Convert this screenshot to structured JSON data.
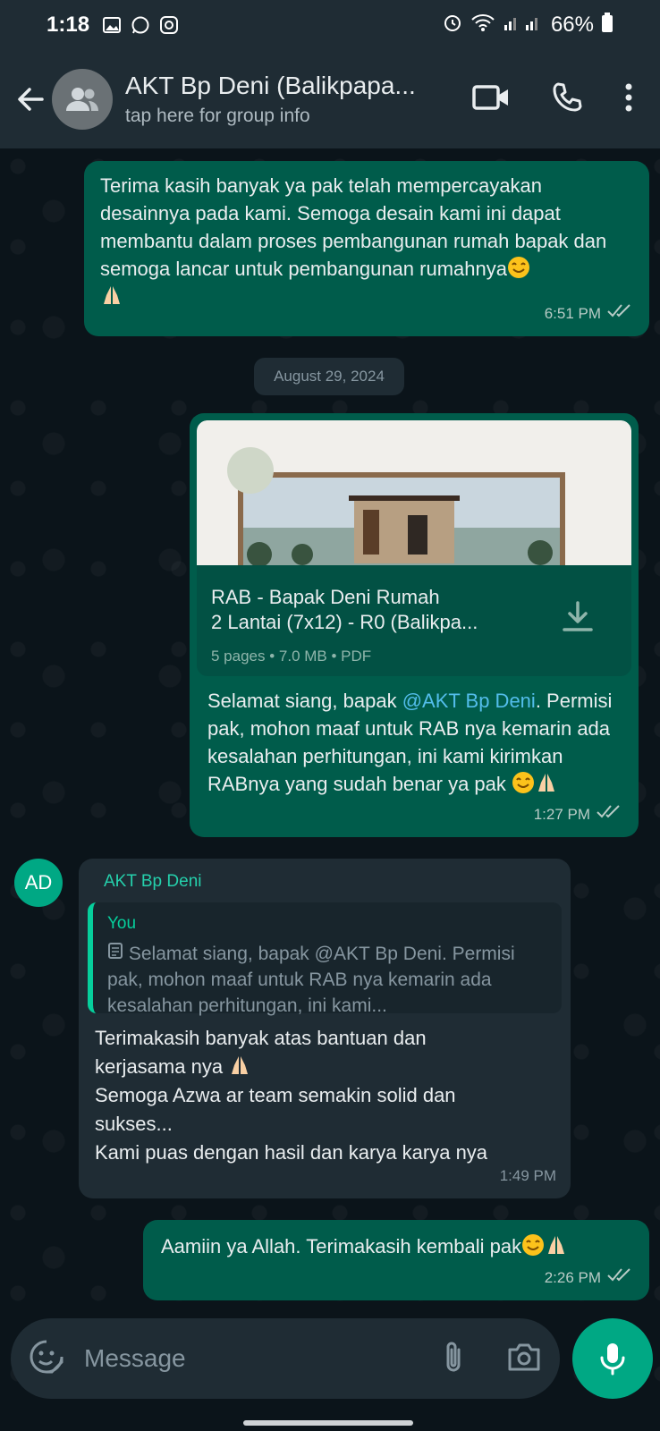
{
  "status_bar": {
    "time": "1:18",
    "battery": "66%"
  },
  "header": {
    "title": "AKT Bp Deni (Balikpapa...",
    "subtitle": "tap here for group info"
  },
  "messages": {
    "m1": {
      "text": "Terima kasih banyak ya pak telah mempercayakan desainnya pada kami. Semoga desain kami ini dapat membantu dalam proses pembangunan rumah bapak dan semoga lancar untuk pembangunan rumahnya",
      "time": "6:51 PM"
    },
    "date_divider": "August 29, 2024",
    "m2": {
      "doc_name_line1": "RAB - Bapak Deni Rumah",
      "doc_name_line2": "2 Lantai (7x12) - R0 (Balikpa...",
      "doc_meta": "5 pages • 7.0 MB • PDF",
      "caption_pre": "Selamat siang, bapak ",
      "caption_mention": "@AKT Bp Deni",
      "caption_post": ". Permisi pak, mohon maaf untuk RAB nya kemarin ada kesalahan perhitungan, ini kami kirimkan RABnya yang sudah benar ya pak",
      "time": "1:27 PM"
    },
    "m3": {
      "avatar": "AD",
      "sender": "AKT Bp Deni",
      "quote_name": "You",
      "quote_text": "Selamat siang, bapak @AKT Bp Deni. Permisi pak, mohon maaf untuk RAB nya kemarin ada kesalahan perhitungan, ini kami...",
      "line1": "Terimakasih banyak atas bantuan dan",
      "line2": "kerjasama nya",
      "line3": "Semoga Azwa ar team semakin solid dan",
      "line4": "sukses...",
      "line5": "Kami puas dengan hasil dan karya karya nya",
      "time": "1:49 PM"
    },
    "m4": {
      "text": "Aamiin ya Allah. Terimakasih kembali pak",
      "time": "2:26 PM"
    }
  },
  "composer": {
    "placeholder": "Message"
  },
  "colors": {
    "outgoing": "#005c4b",
    "incoming": "#1f2c34",
    "accent": "#00a884",
    "background": "#0b141a"
  }
}
